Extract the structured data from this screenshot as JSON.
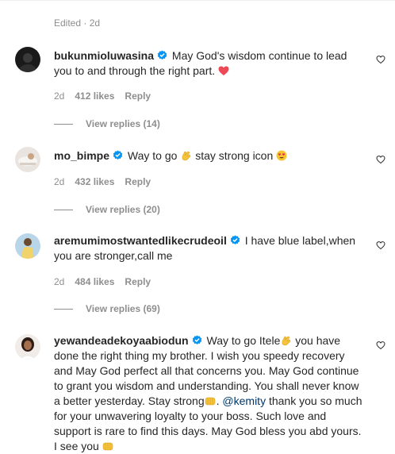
{
  "edited_label": "Edited · 2d",
  "comments": [
    {
      "username": "bukunmioluwasina",
      "verified": true,
      "text_before": "May God's wisdom continue to lead you to and through the right part.",
      "emoji": "red-heart",
      "age": "2d",
      "likes": "412 likes",
      "reply_label": "Reply",
      "view_replies": "View replies (14)"
    },
    {
      "username": "mo_bimpe",
      "verified": true,
      "text_part1": "Way to go",
      "text_part2": "stay strong icon",
      "age": "2d",
      "likes": "432 likes",
      "reply_label": "Reply",
      "view_replies": "View replies (20)"
    },
    {
      "username": "aremumimostwantedlikecrudeoil",
      "verified": true,
      "text": "I have blue label,when you are stronger,call me",
      "age": "2d",
      "likes": "484 likes",
      "reply_label": "Reply",
      "view_replies": "View replies (69)"
    },
    {
      "username": "yewandeadekoyaabiodun",
      "verified": true,
      "text_part1": "Way to go Itele",
      "text_part2": "you have done the right thing my brother. I wish you speedy recovery and May God perfect all that concerns you. May God continue to grant you wisdom and understanding. You shall never know a better yesterday. Stay strong",
      "text_part3": ".",
      "mention": "@kemity",
      "text_part4": "thank you so much for your unwavering loyalty to your boss. Such love and support is rare to find this days. May God bless you abd yours. I see you"
    }
  ],
  "colors": {
    "verified": "#0095f6",
    "muted": "#8e8e8e",
    "heart_emoji": "#ed4956",
    "mention": "#00376b"
  }
}
